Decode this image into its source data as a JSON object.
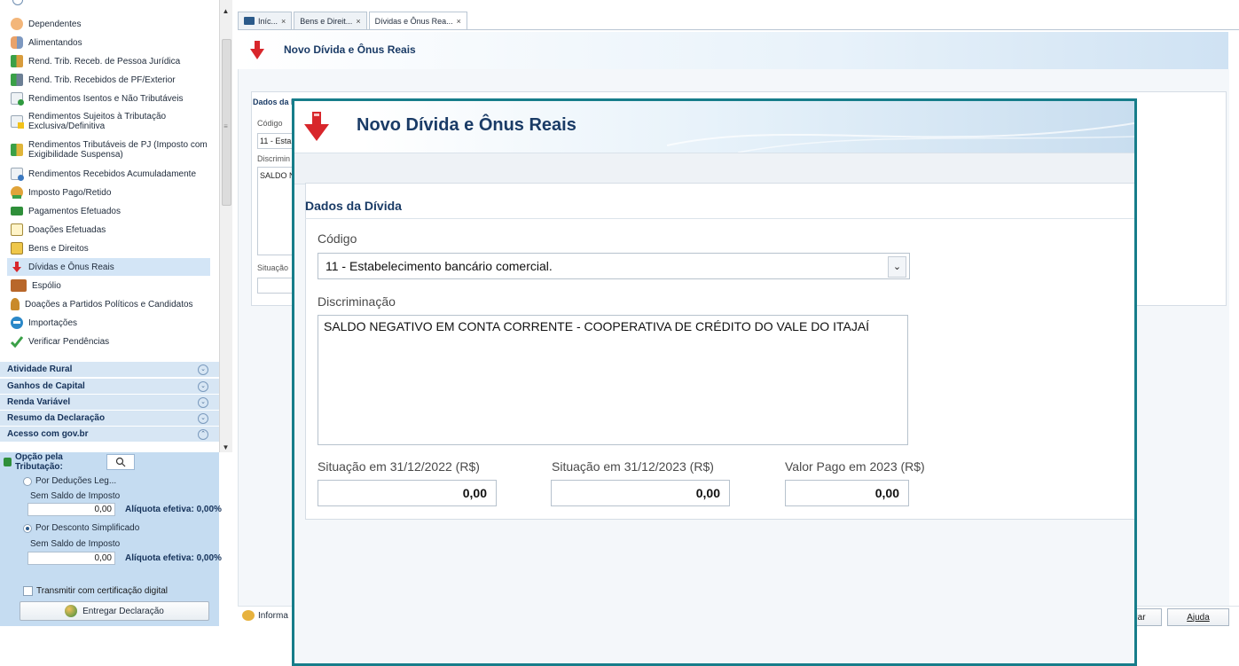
{
  "sidebar": {
    "items": [
      {
        "label": "Dependentes",
        "icon": "dependents-icon"
      },
      {
        "label": "Alimentandos",
        "icon": "dependents-pair-icon"
      },
      {
        "label": "Rend. Trib. Receb. de Pessoa Jurídica",
        "icon": "arrow-money-icon"
      },
      {
        "label": "Rend. Trib. Recebidos de PF/Exterior",
        "icon": "arrow-money-icon"
      },
      {
        "label": "Rendimentos Isentos e Não Tributáveis",
        "icon": "document-check-icon"
      },
      {
        "label_line1": "Rendimentos Sujeitos à Tributação",
        "label_line2": "Exclusiva/Definitiva",
        "icon": "document-warning-icon"
      },
      {
        "label_line1": "Rendimentos Tributáveis de PJ (Imposto com",
        "label_line2": "Exigibilidade Suspensa)",
        "icon": "arrow-money-warning-icon"
      },
      {
        "label": "Rendimentos Recebidos Acumuladamente",
        "icon": "document-clock-icon"
      },
      {
        "label": "Imposto Pago/Retido",
        "icon": "tax-paid-icon"
      },
      {
        "label": "Pagamentos Efetuados",
        "icon": "payment-card-icon"
      },
      {
        "label": "Doações Efetuadas",
        "icon": "donation-icon"
      },
      {
        "label": "Bens e Direitos",
        "icon": "assets-icon"
      },
      {
        "label": "Dívidas e Ônus Reais",
        "icon": "debt-arrow-icon"
      },
      {
        "label": "Espólio",
        "icon": "chest-icon"
      },
      {
        "label": "Doações a Partidos Políticos e Candidatos",
        "icon": "party-donation-icon"
      },
      {
        "label": "Importações",
        "icon": "import-icon"
      },
      {
        "label": "Verificar Pendências",
        "icon": "check-mark-icon"
      }
    ],
    "groups": [
      {
        "label": "Atividade Rural"
      },
      {
        "label": "Ganhos de Capital"
      },
      {
        "label": "Renda Variável"
      },
      {
        "label": "Resumo da Declaração"
      },
      {
        "label": "Acesso com gov.br"
      }
    ]
  },
  "tributacao": {
    "tab_label": "Opção pela Tributação:",
    "option1_label": "Por Deduções Leg...",
    "option1_sub": "Sem Saldo de Imposto",
    "option1_value": "0,00",
    "option1_aliquota": "Alíquota efetiva: 0,00%",
    "option1_selected": false,
    "option2_label": "Por Desconto Simplificado",
    "option2_sub": "Sem Saldo de Imposto",
    "option2_value": "0,00",
    "option2_aliquota": "Alíquota efetiva: 0,00%",
    "option2_selected": true,
    "certificado_label": "Transmitir com certificação digital",
    "entregar_label": "Entregar Declaração"
  },
  "tabs": [
    {
      "label": "Iníc...",
      "close": "×"
    },
    {
      "label": "Bens e Direit...",
      "close": "×"
    },
    {
      "label": "Dívidas e Ônus Rea...",
      "close": "×"
    }
  ],
  "background_form": {
    "header_title": "Novo Dívida e Ônus Reais",
    "section_title": "Dados da D",
    "codigo_label": "Código",
    "codigo_value": "11 - Esta",
    "discr_label": "Discrimin",
    "discr_value": "SALDO N",
    "situacao_label": "Situação",
    "info_label": "Informa",
    "cancel_btn": "lar",
    "help_btn": "Ajuda"
  },
  "dialog": {
    "title": "Novo Dívida e Ônus Reais",
    "section_title": "Dados da Dívida",
    "codigo_label": "Código",
    "codigo_value": "11 - Estabelecimento bancário comercial.",
    "discriminacao_label": "Discriminação",
    "discriminacao_value": "SALDO NEGATIVO EM CONTA CORRENTE - COOPERATIVA DE CRÉDITO DO VALE DO ITAJAÍ",
    "sit2022_label": "Situação em 31/12/2022 (R$)",
    "sit2022_value": "0,00",
    "sit2023_label": "Situação em 31/12/2023 (R$)",
    "sit2023_value": "0,00",
    "pago2023_label": "Valor Pago em 2023 (R$)",
    "pago2023_value": "0,00"
  },
  "colors": {
    "accent_border": "#167d8a",
    "title_blue": "#1a3b66",
    "selected_item": "#d3e5f6",
    "group_bg": "#d7e6f4",
    "debt_red": "#d8262b"
  }
}
